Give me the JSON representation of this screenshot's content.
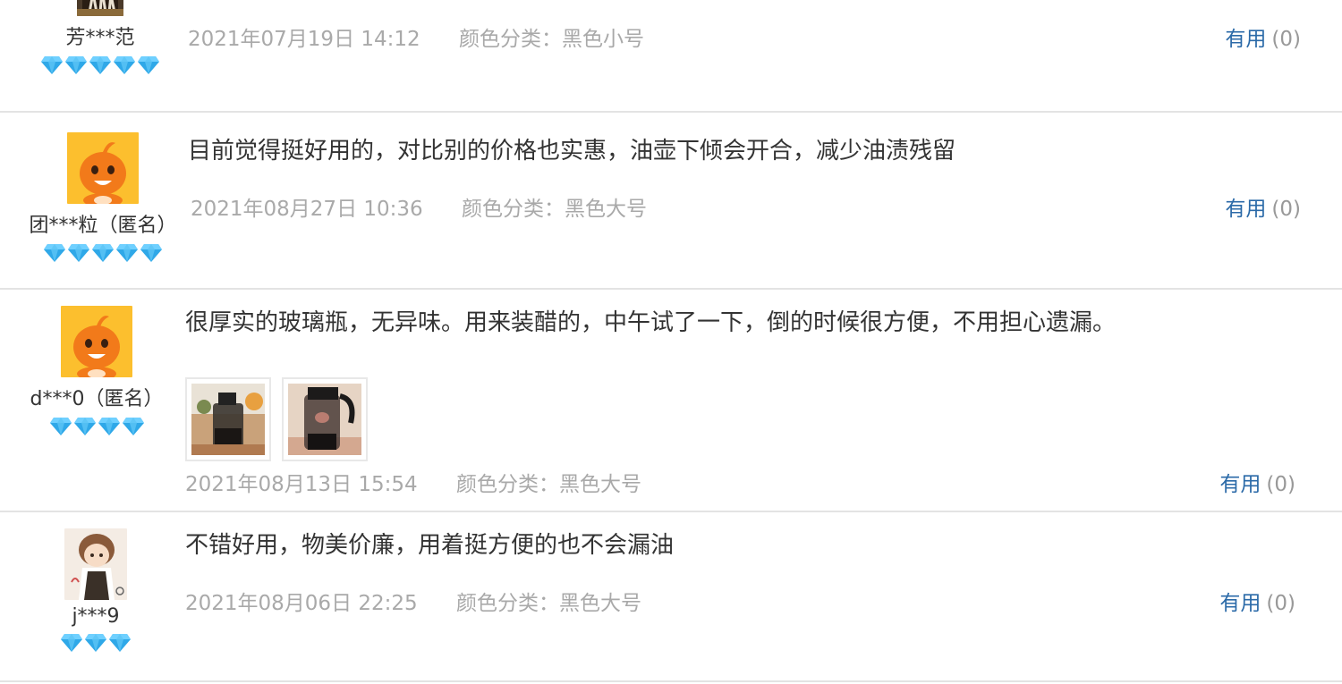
{
  "colors": {
    "link": "#2b6aa8",
    "meta": "#a9a9a9",
    "diamond": "#2fa8e8",
    "divider": "#e3e3e3"
  },
  "icons": {
    "rank": "diamond-icon",
    "avatar": "orange-mascot-avatar"
  },
  "reviews": [
    {
      "user": "芳***范",
      "rank_count": 5,
      "text": "",
      "date": "2021年07月19日 14:12",
      "sku": "颜色分类：黑色小号",
      "useful_label": "有用",
      "useful_count": "(0)"
    },
    {
      "user": "团***粒（匿名）",
      "rank_count": 5,
      "text": "目前觉得挺好用的，对比别的价格也实惠，油壶下倾会开合，减少油渍残留",
      "date": "2021年08月27日 10:36",
      "sku": "颜色分类：黑色大号",
      "useful_label": "有用",
      "useful_count": "(0)"
    },
    {
      "user": "d***0（匿名）",
      "rank_count": 4,
      "text": "很厚实的玻璃瓶，无异味。用来装醋的，中午试了一下，倒的时候很方便，不用担心遗漏。",
      "date": "2021年08月13日 15:54",
      "sku": "颜色分类：黑色大号",
      "useful_label": "有用",
      "useful_count": "(0)",
      "photos": [
        "review-photo-bottle-1",
        "review-photo-bottle-2"
      ]
    },
    {
      "user": "j***9",
      "rank_count": 3,
      "text": "不错好用，物美价廉，用着挺方便的也不会漏油",
      "date": "2021年08月06日 22:25",
      "sku": "颜色分类：黑色大号",
      "useful_label": "有用",
      "useful_count": "(0)"
    }
  ]
}
